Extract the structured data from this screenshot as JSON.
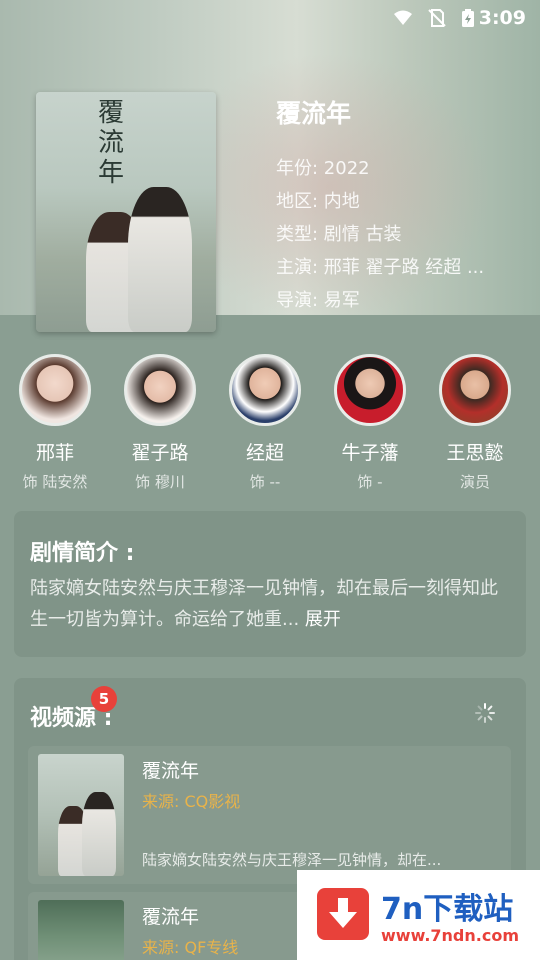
{
  "status_bar": {
    "time": "3:09"
  },
  "drama": {
    "title": "覆流年",
    "poster_calligraphy": "覆流年",
    "year": "年份: 2022",
    "region": "地区: 内地",
    "genre": "类型: 剧情 古装",
    "cast_line": "主演: 邢菲 翟子路 经超 ...",
    "director": "导演: 易军"
  },
  "cast": [
    {
      "name": "邢菲",
      "role": "饰 陆安然"
    },
    {
      "name": "翟子路",
      "role": "饰 穆川"
    },
    {
      "name": "经超",
      "role": "饰 --"
    },
    {
      "name": "牛子藩",
      "role": "饰 -"
    },
    {
      "name": "王思懿",
      "role": "演员"
    }
  ],
  "synopsis": {
    "heading": "剧情简介 :",
    "text": "陆家嫡女陆安然与庆王穆泽一见钟情，却在最后一刻得知此生一切皆为算计。命运给了她重...",
    "expand_label": "展开"
  },
  "sources": {
    "heading": "视频源 :",
    "badge_count": "5",
    "items": [
      {
        "title": "覆流年",
        "source": "来源: CQ影视",
        "desc": "陆家嫡女陆安然与庆王穆泽一见钟情，却在..."
      },
      {
        "title": "覆流年",
        "source": "来源: QF专线",
        "desc": ""
      }
    ]
  },
  "watermark": {
    "title": "7n下载站",
    "url": "www.7ndn.com"
  },
  "colors": {
    "accent": "#e8413a",
    "source_label": "#e8b34a",
    "watermark_blue": "#1f5fc0"
  }
}
